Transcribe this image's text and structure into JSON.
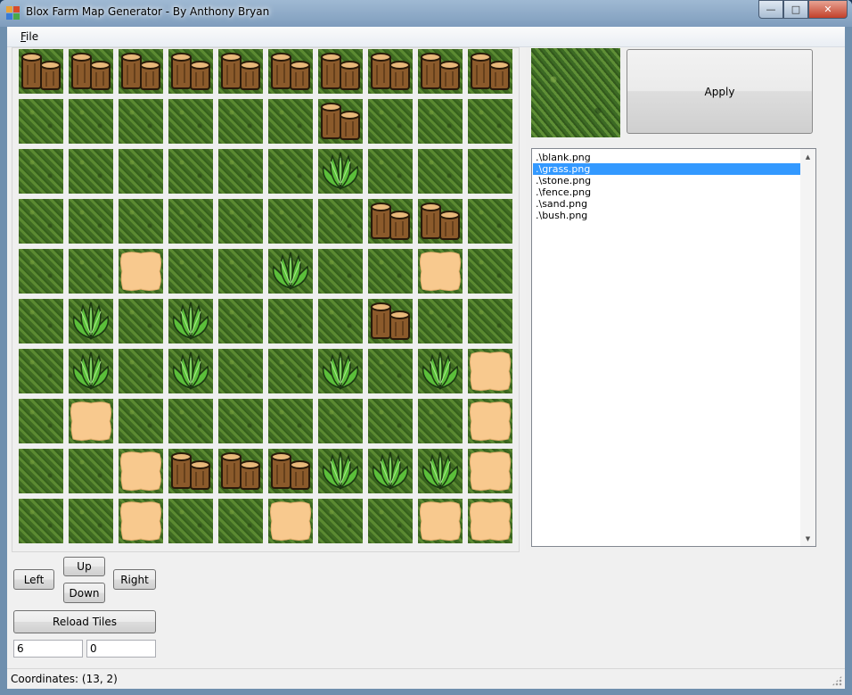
{
  "window": {
    "title": "Blox Farm Map Generator - By Anthony Bryan",
    "minimize_glyph": "—",
    "maximize_glyph": "□",
    "close_glyph": "✕"
  },
  "menu": {
    "file_mnemonic": "F",
    "file_rest": "ile"
  },
  "map": {
    "rows": [
      [
        "fence",
        "fence",
        "fence",
        "fence",
        "fence",
        "fence",
        "fence",
        "fence",
        "fence",
        "fence"
      ],
      [
        "grass",
        "grass",
        "grass",
        "grass",
        "grass",
        "grass",
        "fence",
        "grass",
        "grass",
        "grass"
      ],
      [
        "grass",
        "grass",
        "grass",
        "grass",
        "grass",
        "grass",
        "bush",
        "grass",
        "grass",
        "grass"
      ],
      [
        "grass",
        "grass",
        "grass",
        "grass",
        "grass",
        "grass",
        "grass",
        "fence",
        "fence",
        "grass"
      ],
      [
        "grass",
        "grass",
        "sand",
        "grass",
        "grass",
        "bush",
        "grass",
        "grass",
        "sand",
        "grass"
      ],
      [
        "grass",
        "bush",
        "grass",
        "bush",
        "grass",
        "grass",
        "grass",
        "fence",
        "grass",
        "grass"
      ],
      [
        "grass",
        "bush",
        "grass",
        "bush",
        "grass",
        "grass",
        "bush",
        "grass",
        "bush",
        "sand"
      ],
      [
        "grass",
        "sand",
        "grass",
        "grass",
        "grass",
        "grass",
        "grass",
        "grass",
        "grass",
        "sand"
      ],
      [
        "grass",
        "grass",
        "sand",
        "fence",
        "fence",
        "fence",
        "bush",
        "bush",
        "bush",
        "sand"
      ],
      [
        "grass",
        "grass",
        "sand",
        "grass",
        "grass",
        "sand",
        "grass",
        "grass",
        "sand",
        "sand"
      ]
    ]
  },
  "preview": {
    "tile": "grass"
  },
  "apply_label": "Apply",
  "tile_list": {
    "items": [
      ".\\blank.png",
      ".\\grass.png",
      ".\\stone.png",
      ".\\fence.png",
      ".\\sand.png",
      ".\\bush.png"
    ],
    "selected_index": 1
  },
  "nav": {
    "left": "Left",
    "up": "Up",
    "down": "Down",
    "right": "Right"
  },
  "reload_label": "Reload Tiles",
  "inputs": {
    "x_value": "6",
    "y_value": "0"
  },
  "status": {
    "text": "Coordinates: (13, 2)"
  },
  "colors": {
    "selection": "#3399ff",
    "grass": "#4a7a2a",
    "sand": "#f8c98e",
    "wood": "#8b5a2b"
  }
}
